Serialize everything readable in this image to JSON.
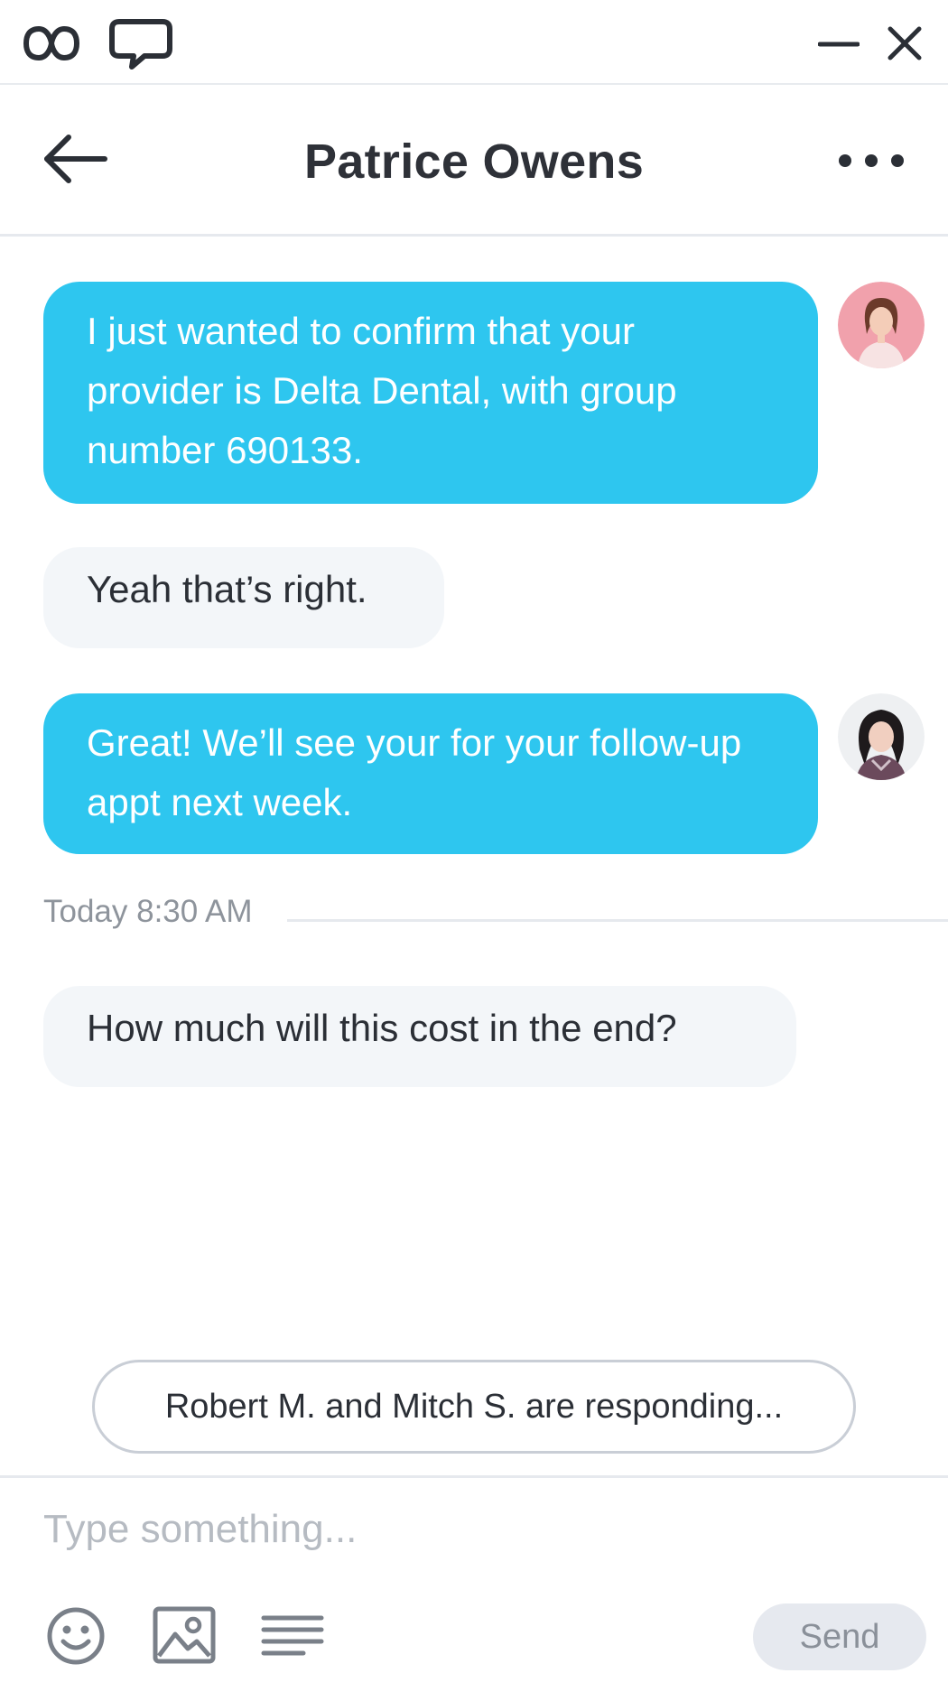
{
  "app": {
    "icons": [
      "infinity-logo-icon",
      "chat-bubble-icon",
      "minimize-icon",
      "close-icon"
    ]
  },
  "header": {
    "title": "Patrice Owens",
    "back_icon": "arrow-left-icon",
    "more_icon": "more-horizontal-icon"
  },
  "messages": [
    {
      "direction": "outgoing",
      "text": "I just wanted to confirm that your provider is Delta Dental, with group number 690133.",
      "avatar": "agent-avatar-1"
    },
    {
      "direction": "incoming",
      "text": "Yeah that’s right."
    },
    {
      "direction": "outgoing",
      "text": "Great! We’ll see your for your follow-up appt next week.",
      "avatar": "agent-avatar-2"
    }
  ],
  "timestamp": "Today 8:30 AM",
  "messages_after": [
    {
      "direction": "incoming",
      "text": "How much will this cost in the end?"
    }
  ],
  "typing_indicator": "Robert M. and Mitch S. are responding...",
  "composer": {
    "placeholder": "Type something...",
    "value": "",
    "tools": [
      "emoji-icon",
      "image-icon",
      "text-format-icon"
    ],
    "send_label": "Send"
  },
  "colors": {
    "outgoing_bubble": "#2ec6ef",
    "incoming_bubble": "#f3f6f9",
    "send_button_bg": "#e6e9ef"
  }
}
